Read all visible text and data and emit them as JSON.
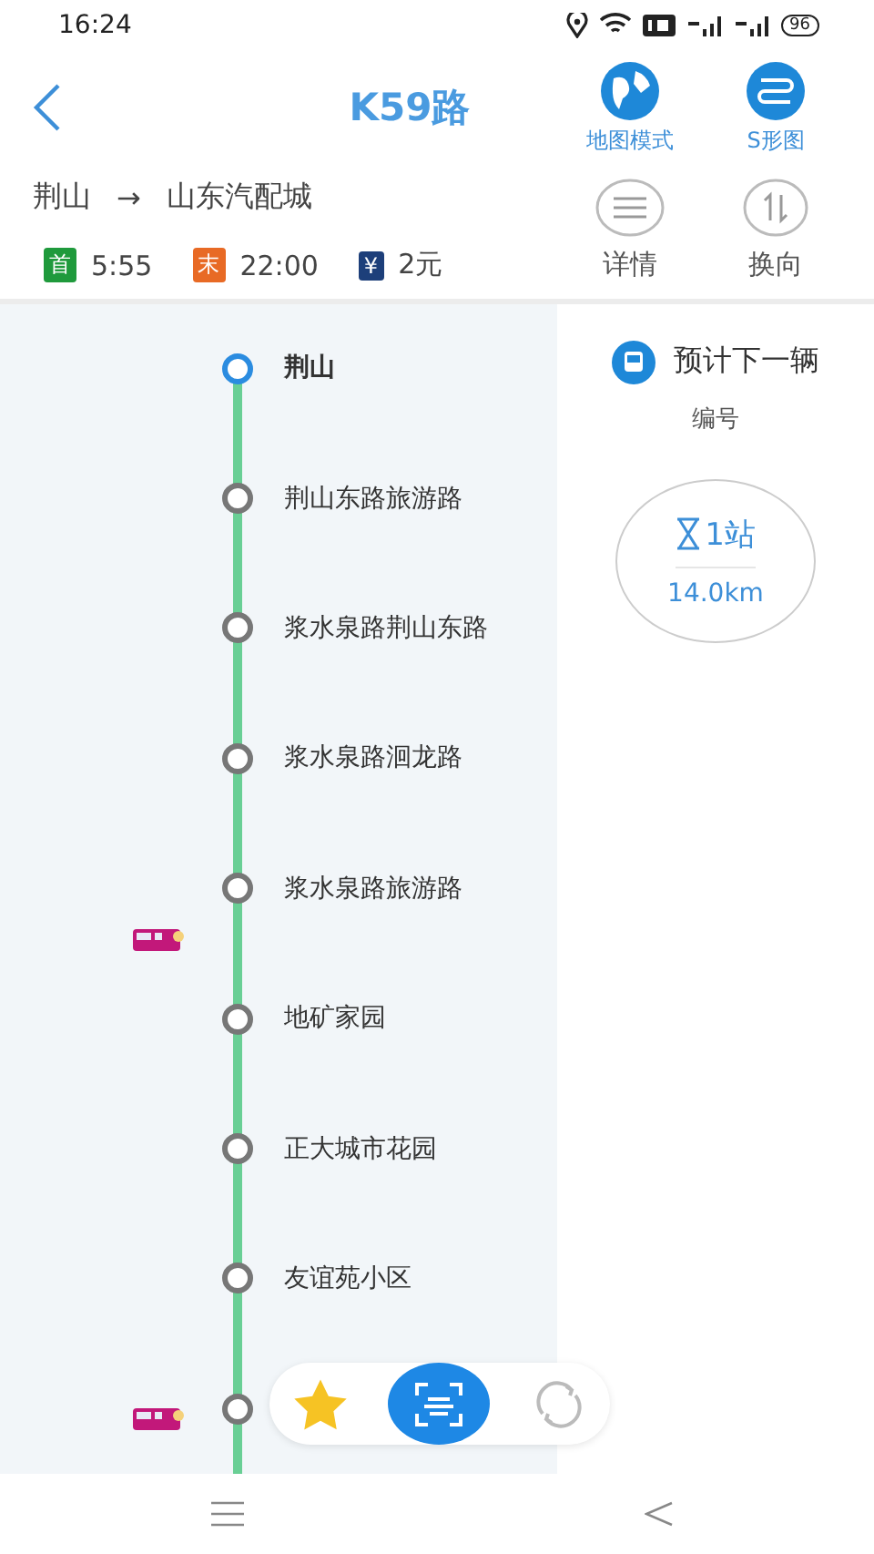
{
  "status_bar": {
    "time": "16:24",
    "battery": "96"
  },
  "header": {
    "title": "K59路",
    "actions": [
      {
        "label": "地图模式",
        "kind": "globe"
      },
      {
        "label": "S形图",
        "kind": "route"
      }
    ]
  },
  "route": {
    "from": "荆山",
    "arrow": "→",
    "to": "山东汽配城"
  },
  "info": [
    {
      "tag": "首",
      "value": "5:55",
      "kind": "first"
    },
    {
      "tag": "末",
      "value": "22:00",
      "kind": "last"
    },
    {
      "tag": "¥",
      "value": "2元",
      "kind": "fare"
    }
  ],
  "tools": [
    {
      "label": "详情",
      "kind": "list"
    },
    {
      "label": "换向",
      "kind": "swap"
    }
  ],
  "stops": [
    {
      "name": "荆山",
      "selected": true
    },
    {
      "name": "荆山东路旅游路",
      "selected": false
    },
    {
      "name": "浆水泉路荆山东路",
      "selected": false
    },
    {
      "name": "浆水泉路洄龙路",
      "selected": false
    },
    {
      "name": "浆水泉路旅游路",
      "selected": false,
      "bus_after": true
    },
    {
      "name": "地矿家园",
      "selected": false
    },
    {
      "name": "正大城市花园",
      "selected": false
    },
    {
      "name": "友谊苑小区",
      "selected": false
    },
    {
      "selected": false,
      "bus_at": true
    }
  ],
  "next_bus": {
    "title": "预计下一辆",
    "subtitle": "编号",
    "stations": "1站",
    "distance": "14.0km"
  },
  "float_bar": [
    {
      "kind": "favorite"
    },
    {
      "kind": "scan"
    },
    {
      "kind": "refresh"
    }
  ]
}
